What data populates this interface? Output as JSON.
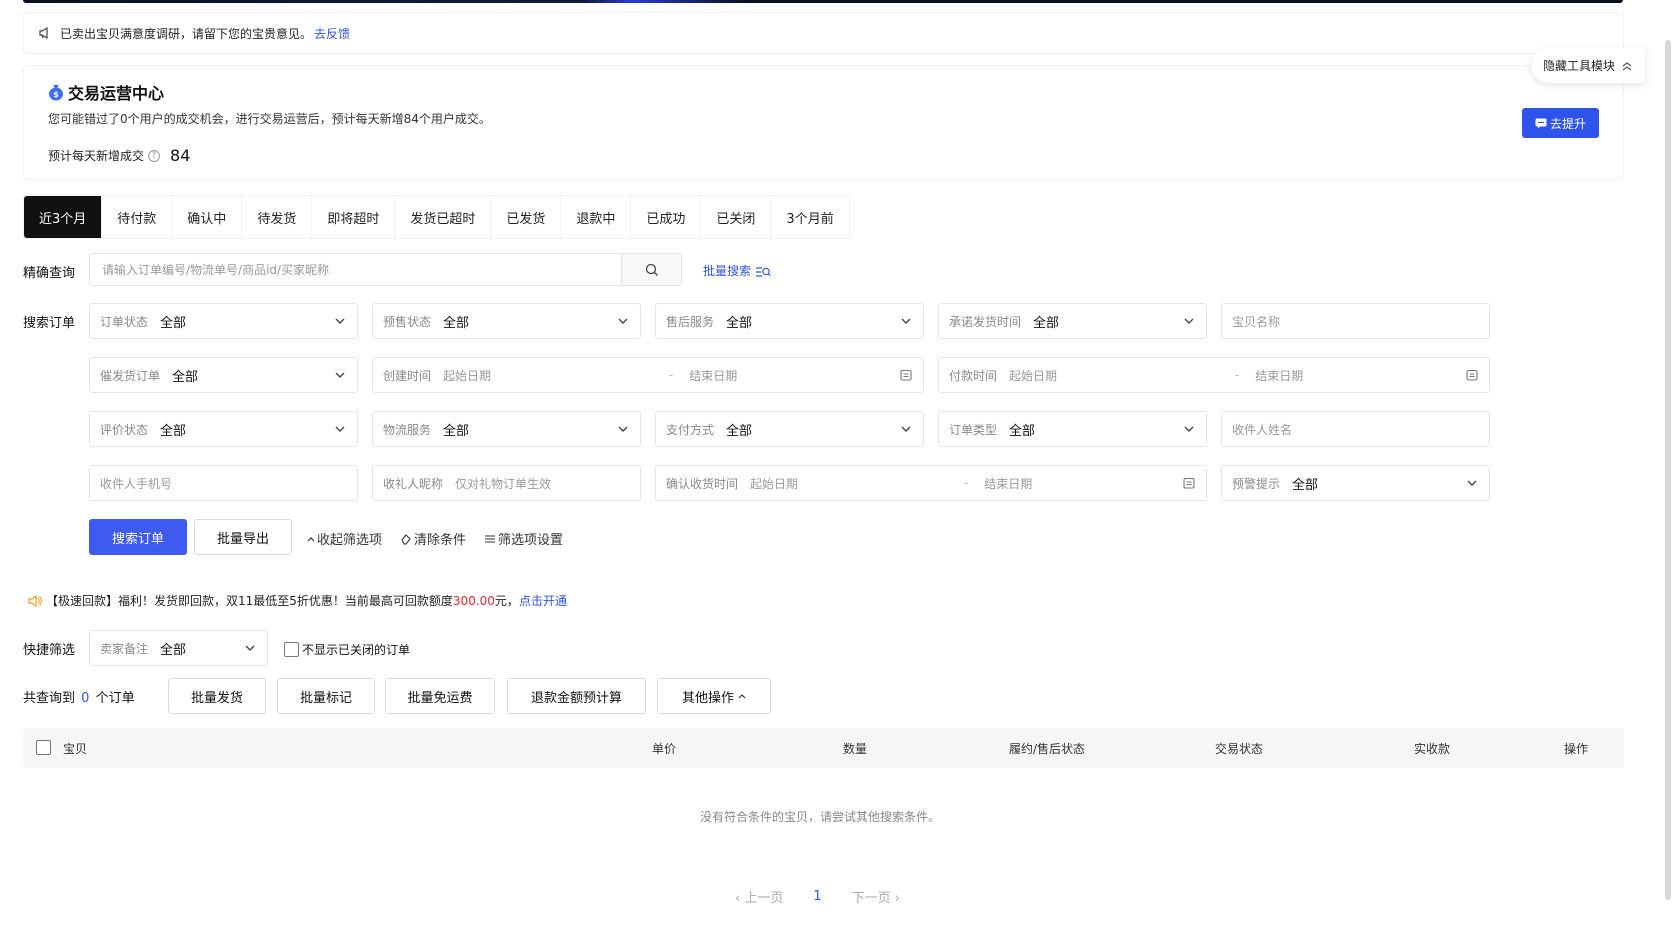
{
  "notice": {
    "text": "已卖出宝贝满意度调研，请留下您的宝贵意见。",
    "link": "去反馈"
  },
  "ops_center": {
    "title": "交易运营中心",
    "desc": "您可能错过了0个用户的成交机会，进行交易运营后，预计每天新增84个用户成交。",
    "metric_label": "预计每天新增成交",
    "metric_value": "84",
    "boost_button": "去提升"
  },
  "hide_tool": "隐藏工具模块",
  "tabs": [
    "近3个月",
    "待付款",
    "确认中",
    "待发货",
    "即将超时",
    "发货已超时",
    "已发货",
    "退款中",
    "已成功",
    "已关闭",
    "3个月前"
  ],
  "precise_search": {
    "label": "精确查询",
    "placeholder": "请输入订单编号/物流单号/商品id/买家昵称",
    "batch": "批量搜索"
  },
  "search_orders": {
    "label": "搜索订单",
    "fields": {
      "order_status": {
        "label": "订单状态",
        "value": "全部"
      },
      "presale_status": {
        "label": "预售状态",
        "value": "全部"
      },
      "after_sale": {
        "label": "售后服务",
        "value": "全部"
      },
      "promise_ship": {
        "label": "承诺发货时间",
        "value": "全部"
      },
      "item_name": {
        "placeholder": "宝贝名称"
      },
      "urge_ship": {
        "label": "催发货订单",
        "value": "全部"
      },
      "create_time": {
        "label": "创建时间",
        "start": "起始日期",
        "sep": "-",
        "end": "结束日期"
      },
      "pay_time": {
        "label": "付款时间",
        "start": "起始日期",
        "sep": "-",
        "end": "结束日期"
      },
      "review_status": {
        "label": "评价状态",
        "value": "全部"
      },
      "logistics": {
        "label": "物流服务",
        "value": "全部"
      },
      "pay_method": {
        "label": "支付方式",
        "value": "全部"
      },
      "order_type": {
        "label": "订单类型",
        "value": "全部"
      },
      "receiver_name": {
        "placeholder": "收件人姓名"
      },
      "receiver_phone": {
        "placeholder": "收件人手机号"
      },
      "gift_nick": {
        "label": "收礼人昵称",
        "placeholder": "仅对礼物订单生效"
      },
      "confirm_time": {
        "label": "确认收货时间",
        "start": "起始日期",
        "sep": "-",
        "end": "结束日期"
      },
      "warning": {
        "label": "预警提示",
        "value": "全部"
      }
    }
  },
  "actions": {
    "search": "搜索订单",
    "export": "批量导出",
    "collapse": "收起筛选项",
    "clear": "清除条件",
    "settings": "筛选项设置"
  },
  "promo": {
    "text1": "【极速回款】福利！发货即回款，双11最低至5折优惠！当前最高可回款额度",
    "amount": "300.00",
    "text2": "元，",
    "link": "点击开通"
  },
  "quick_filter": {
    "label": "快捷筛选",
    "seller_note": {
      "label": "卖家备注",
      "value": "全部"
    },
    "hide_closed": "不显示已关闭的订单"
  },
  "result": {
    "prefix": "共查询到",
    "count": "0",
    "suffix": "个订单",
    "buttons": [
      "批量发货",
      "批量标记",
      "批量免运费",
      "退款金额预计算",
      "其他操作"
    ]
  },
  "table": {
    "headers": [
      "宝贝",
      "单价",
      "数量",
      "履约/售后状态",
      "交易状态",
      "实收款",
      "操作"
    ],
    "empty": "没有符合条件的宝贝，请尝试其他搜索条件。"
  },
  "pager": {
    "prev": "上一页",
    "current": "1",
    "next": "下一页"
  }
}
